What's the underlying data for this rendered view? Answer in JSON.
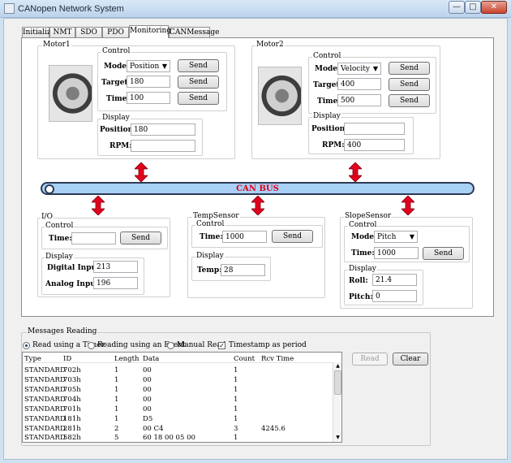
{
  "window": {
    "title": "CANopen Network System"
  },
  "tabs": [
    "Initialize",
    "NMT",
    "SDO",
    "PDO",
    "Monitoring",
    "CANMessage"
  ],
  "motor1": {
    "title": "Motor1",
    "control": {
      "title": "Control",
      "mode_label": "Mode:",
      "mode_value": "Position",
      "target_label": "Target:",
      "target_value": "180",
      "time_label": "Time:",
      "time_value": "100",
      "send": "Send"
    },
    "display": {
      "title": "Display",
      "position_label": "Position:",
      "position_value": "180",
      "rpm_label": "RPM:",
      "rpm_value": ""
    }
  },
  "motor2": {
    "title": "Motor2",
    "control": {
      "title": "Control",
      "mode_label": "Mode:",
      "mode_value": "Velocity",
      "target_label": "Target:",
      "target_value": "400",
      "time_label": "Time:",
      "time_value": "500",
      "send": "Send"
    },
    "display": {
      "title": "Display",
      "position_label": "Position:",
      "position_value": "",
      "rpm_label": "RPM:",
      "rpm_value": "400"
    }
  },
  "canbus": {
    "label": "CAN BUS"
  },
  "io": {
    "title": "I/O",
    "control": {
      "title": "Control",
      "time_label": "Time:",
      "time_value": "",
      "send": "Send"
    },
    "display": {
      "title": "Display",
      "digital_label": "Digital Input:",
      "digital_value": "213",
      "analog_label": "Analog Input:",
      "analog_value": "196"
    }
  },
  "temp": {
    "title": "TempSensor",
    "control": {
      "title": "Control",
      "time_label": "Time:",
      "time_value": "1000",
      "send": "Send"
    },
    "display": {
      "title": "Display",
      "temp_label": "Temp:",
      "temp_value": "28"
    }
  },
  "slope": {
    "title": "SlopeSensor",
    "control": {
      "title": "Control",
      "mode_label": "Mode:",
      "mode_value": "Pitch",
      "time_label": "Time:",
      "time_value": "1000",
      "send": "Send"
    },
    "display": {
      "title": "Display",
      "roll_label": "Roll:",
      "roll_value": "21.4",
      "pitch_label": "Pitch:",
      "pitch_value": "0"
    }
  },
  "messages": {
    "title": "Messages Reading",
    "radio_timer": "Read using a Timer",
    "radio_event": "Reading using an Event",
    "radio_manual": "Manual Read",
    "checkbox_timestamp": "Timestamp as period",
    "read_button": "Read",
    "clear_button": "Clear",
    "columns": [
      "Type",
      "ID",
      "Length",
      "Data",
      "Count",
      "Rcv Time"
    ],
    "rows": [
      [
        "STANDARD",
        "702h",
        "1",
        "00",
        "1",
        ""
      ],
      [
        "STANDARD",
        "703h",
        "1",
        "00",
        "1",
        ""
      ],
      [
        "STANDARD",
        "705h",
        "1",
        "00",
        "1",
        ""
      ],
      [
        "STANDARD",
        "704h",
        "1",
        "00",
        "1",
        ""
      ],
      [
        "STANDARD",
        "701h",
        "1",
        "00",
        "1",
        ""
      ],
      [
        "STANDARD",
        "181h",
        "1",
        "D5",
        "1",
        ""
      ],
      [
        "STANDARD",
        "281h",
        "2",
        "00 C4",
        "3",
        "4245.6"
      ],
      [
        "STANDARD",
        "582h",
        "5",
        "60 18 00 05 00",
        "1",
        ""
      ]
    ]
  }
}
